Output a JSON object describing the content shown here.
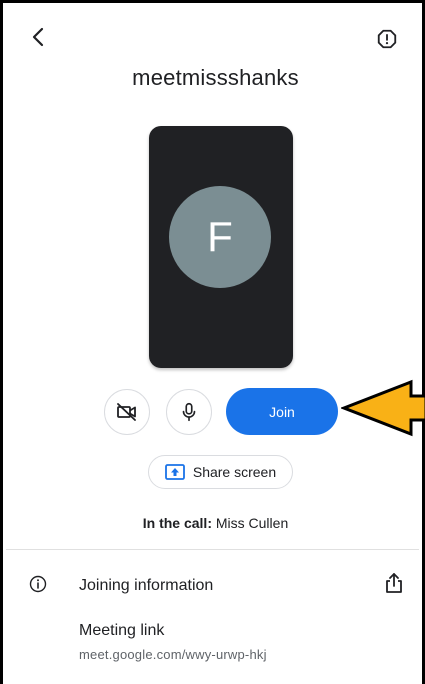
{
  "header": {
    "back_icon": "chevron-left-icon",
    "report_icon": "report-problem-icon"
  },
  "meeting": {
    "title": "meetmissshanks"
  },
  "preview": {
    "avatar_letter": "F",
    "avatar_color": "#7b8e93",
    "background": "#202124"
  },
  "controls": {
    "camera_icon": "camera-off-icon",
    "mic_icon": "mic-icon",
    "join_label": "Join",
    "join_color": "#1a73e8",
    "share_label": "Share screen",
    "share_icon": "present-to-all-icon"
  },
  "annotation": {
    "arrow_color": "#f9b116"
  },
  "participants": {
    "prefix": "In the call:",
    "names": "Miss Cullen"
  },
  "joining_info": {
    "title": "Joining information",
    "link_label": "Meeting link",
    "link_url": "meet.google.com/wwy-urwp-hkj"
  }
}
